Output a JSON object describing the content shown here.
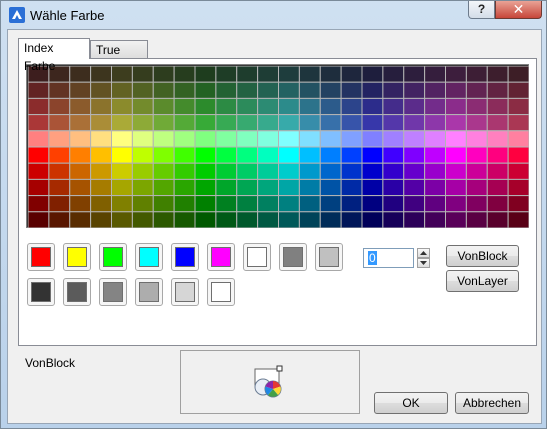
{
  "window": {
    "title": "Wähle Farbe",
    "help_label": "?",
    "close_label": "✕"
  },
  "tabs": [
    {
      "label": "Index Farbe",
      "active": true
    },
    {
      "label": "True Color",
      "active": false
    }
  ],
  "palette": {
    "columns": 24,
    "rows": 10,
    "hue_columns": [
      "#ff0000",
      "#ff4000",
      "#ff7f00",
      "#ffbf00",
      "#ffff00",
      "#bfff00",
      "#7fff00",
      "#40ff00",
      "#00ff00",
      "#00ff40",
      "#00ff7f",
      "#00ffbf",
      "#00ffff",
      "#00bfff",
      "#007fff",
      "#0040ff",
      "#0000ff",
      "#4000ff",
      "#7f00ff",
      "#bf00ff",
      "#ff00ff",
      "#ff00bf",
      "#ff007f",
      "#ff0040"
    ]
  },
  "standard_colors": {
    "row1": [
      "#ff0000",
      "#ffff00",
      "#00ff00",
      "#00ffff",
      "#0000ff",
      "#ff00ff",
      "#ffffff",
      "#808080",
      "#c0c0c0"
    ],
    "row2": [
      "#333333",
      "#5b5b5b",
      "#848484",
      "#adadad",
      "#d6d6d6",
      "#ffffff"
    ]
  },
  "color_index": {
    "value": "0"
  },
  "buttons": {
    "von_block": "VonBlock",
    "von_layer": "VonLayer",
    "ok": "OK",
    "cancel": "Abbrechen"
  },
  "selection_label": "VonBlock"
}
